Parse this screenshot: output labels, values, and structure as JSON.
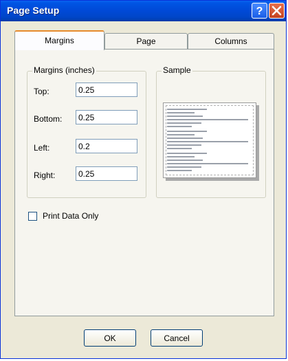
{
  "window": {
    "title": "Page Setup"
  },
  "titlebar_buttons": {
    "help_icon": "question-mark",
    "close_icon": "x-mark"
  },
  "tabs": [
    {
      "label": "Margins",
      "active": true
    },
    {
      "label": "Page",
      "active": false
    },
    {
      "label": "Columns",
      "active": false
    }
  ],
  "margins_group": {
    "title": "Margins (inches)",
    "fields": [
      {
        "label": "Top:",
        "value": "0.25"
      },
      {
        "label": "Bottom:",
        "value": "0.25"
      },
      {
        "label": "Left:",
        "value": "0.2"
      },
      {
        "label": "Right:",
        "value": "0.25"
      }
    ]
  },
  "sample_group": {
    "title": "Sample"
  },
  "print_data_only": {
    "label": "Print Data Only",
    "checked": false
  },
  "buttons": {
    "ok": "OK",
    "cancel": "Cancel"
  },
  "colors": {
    "titlebar": "#0054e3",
    "dialog_bg": "#ece9d8",
    "close_button": "#c4421f",
    "tab_highlight": "#e68b2c"
  }
}
